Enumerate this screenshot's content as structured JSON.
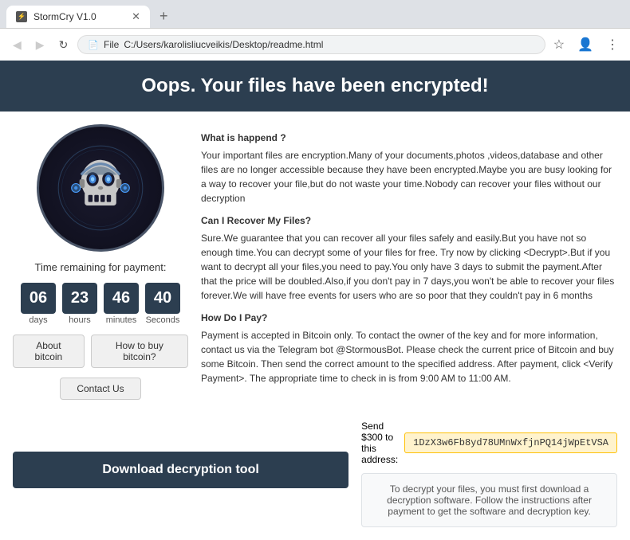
{
  "browser": {
    "tab_title": "StormCry V1.0",
    "address": "C:/Users/karolisliucveikis/Desktop/readme.html",
    "address_prefix": "File",
    "back_icon": "◀",
    "forward_icon": "▶",
    "refresh_icon": "↻",
    "new_tab_icon": "+"
  },
  "page": {
    "header": "Oops. Your files have been encrypted!",
    "what_happened_title": "What is happend ?",
    "what_happened_text": "Your important files are encryption.Many of your documents,photos ,videos,database and other files are no longer accessible because they have been encrypted.Maybe you are busy looking for a way to recover your file,but do not waste your time.Nobody can recover your files without our decryption",
    "can_recover_title": "Can I Recover My Files?",
    "can_recover_text": "Sure.We guarantee that you can recover all your files safely and easily.But you have not so enough time.You can decrypt some of your files for free. Try now by clicking <Decrypt>.But if you want to decrypt all your files,you need to pay.You only have 3 days to submit the payment.After that the price will be doubled.Also,if you don't pay in 7 days,you won't be able to recover your files forever.We will have free events for users who are so poor that they couldn't pay in 6 months",
    "how_pay_title": "How Do I Pay?",
    "how_pay_text": "Payment is accepted in Bitcoin only. To contact the owner of the key and for more information, contact us via the Telegram bot @StormousBot. Please check the current price of Bitcoin and buy some Bitcoin. Then send the correct amount to the specified address. After payment, click <Verify Payment>. The appropriate time to check in is from 9:00 AM to 11:00 AM.",
    "timer_label": "Time remaining for payment:",
    "timer": {
      "days": "06",
      "hours": "23",
      "minutes": "46",
      "seconds": "40",
      "days_label": "days",
      "hours_label": "hours",
      "minutes_label": "minutes",
      "seconds_label": "Seconds"
    },
    "btn_about_bitcoin": "About bitcoin",
    "btn_how_to_buy": "How to buy bitcoin?",
    "btn_contact": "Contact Us",
    "btn_download": "Download decryption tool",
    "send_label": "Send $300 to this address:",
    "bitcoin_address": "1DzX3w6Fb8yd78UMnWxfjnPQ14jWpEtVSA",
    "footer_note": "To decrypt your files, you must first download a decryption software. Follow the instructions after payment to get the software and decryption key."
  }
}
